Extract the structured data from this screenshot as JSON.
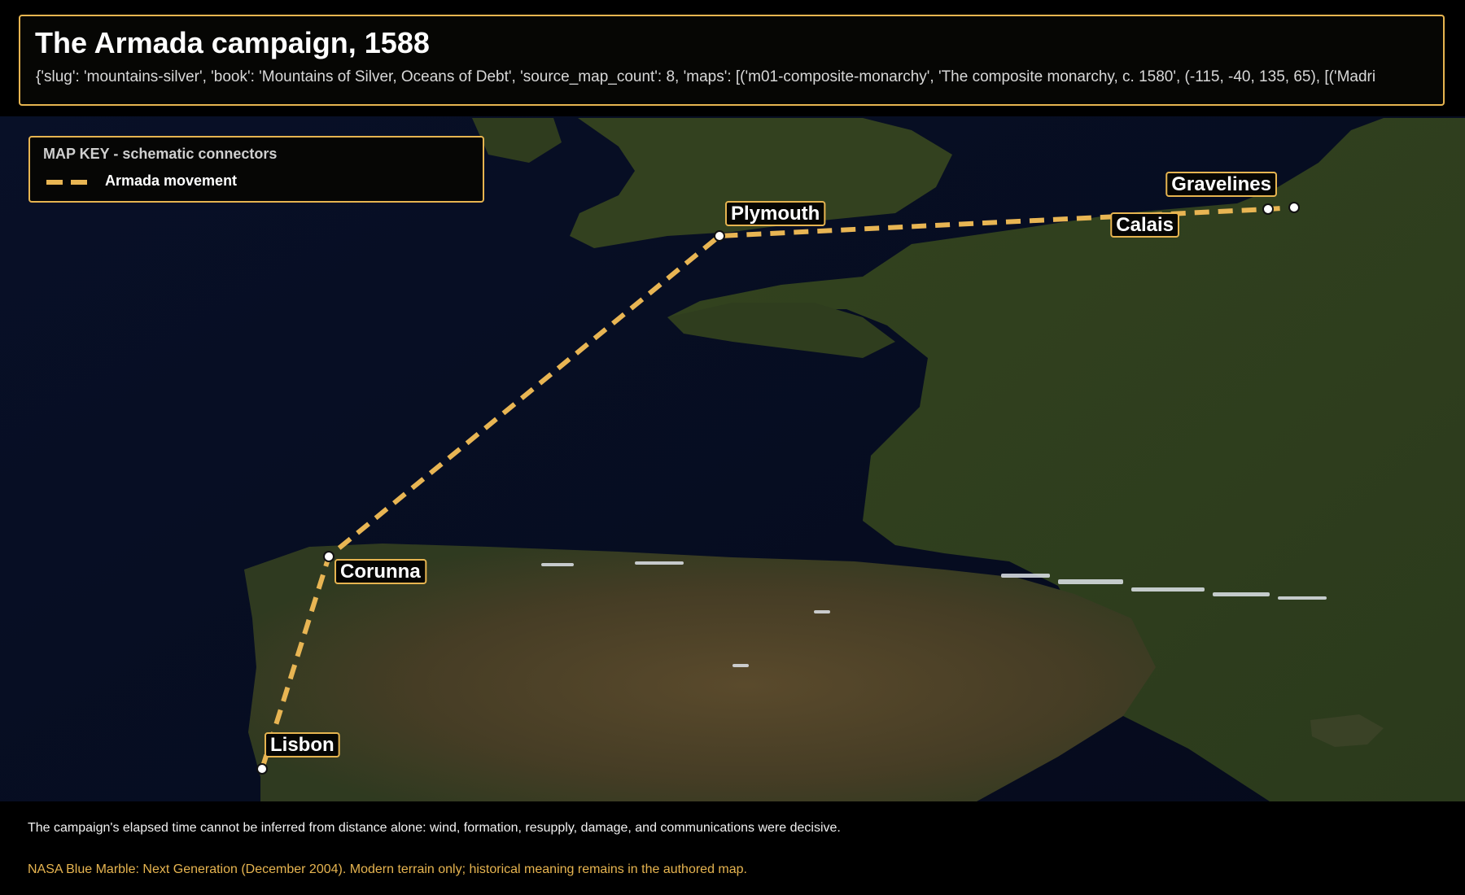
{
  "title": "The Armada campaign, 1588",
  "metadata_line": "{'slug': 'mountains-silver', 'book': 'Mountains of Silver, Oceans of Debt', 'source_map_count': 8, 'maps': [('m01-composite-monarchy', 'The composite monarchy, c. 1580', (-115, -40, 135, 65), [('Madri",
  "legend": {
    "title": "MAP KEY - schematic connectors",
    "items": [
      {
        "label": "Armada movement",
        "color": "#e8b553",
        "style": "dashed"
      }
    ]
  },
  "places": [
    {
      "name": "Lisbon"
    },
    {
      "name": "Corunna"
    },
    {
      "name": "Plymouth"
    },
    {
      "name": "Calais"
    },
    {
      "name": "Gravelines"
    }
  ],
  "route": {
    "name": "Armada movement",
    "order": [
      "Lisbon",
      "Corunna",
      "Plymouth",
      "Calais",
      "Gravelines"
    ],
    "color": "#e8b553"
  },
  "footer": {
    "note": "The campaign's elapsed time cannot be inferred from distance alone: wind, formation, resupply, damage, and communications were decisive.",
    "source": "NASA Blue Marble: Next Generation (December 2004). Modern terrain only; historical meaning remains in the authored map."
  },
  "colors": {
    "accent": "#e6b450",
    "panel_bg": "#060604",
    "sea": "#070b1e",
    "land": "#3a4426"
  }
}
